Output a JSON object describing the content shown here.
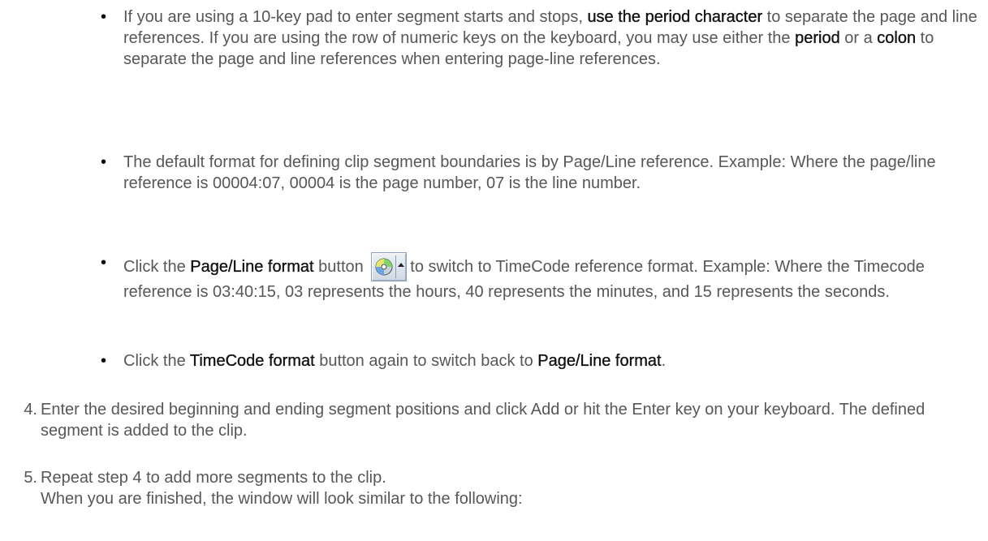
{
  "bullets": [
    {
      "seg1": "If you are using a 10-key pad to enter segment starts and stops, ",
      "bold1": "use the period character",
      "seg2": " to separate the page and line references. If you are using the row of numeric keys on the keyboard, you may use either the ",
      "bold2": "period",
      "seg3": " or a ",
      "bold3": "colon",
      "seg4": " to separate the page and line references when entering page-line references."
    },
    {
      "text": "The default format for defining clip segment boundaries is by Page/Line reference. Example: Where the page/line reference is 00004:07, 00004 is the page number, 07 is the line number."
    },
    {
      "seg1": "Click the ",
      "bold1": "Page/Line format",
      "seg2": " button ",
      "seg3": "to switch to TimeCode reference format. Example: Where the Timecode reference is 03:40:15, 03 represents the hours, 40 represents the minutes, and 15 represents the seconds.",
      "button_icon": "cd-disc-icon"
    },
    {
      "seg1": "Click the ",
      "bold1": "TimeCode format",
      "seg2": " button again to switch back to ",
      "bold2": "Page/Line format",
      "seg3": "."
    }
  ],
  "steps": [
    {
      "number": "4.",
      "text": "Enter the desired beginning and ending segment positions and click Add or hit the Enter key on your keyboard. The defined segment is added to the clip."
    },
    {
      "number": "5.",
      "line1": "Repeat step 4 to add more segments to the clip.",
      "line2": "When you are finished, the window will look similar to the following:"
    }
  ],
  "colors": {
    "body_text": "#575757",
    "emphasis_text": "#111111"
  }
}
